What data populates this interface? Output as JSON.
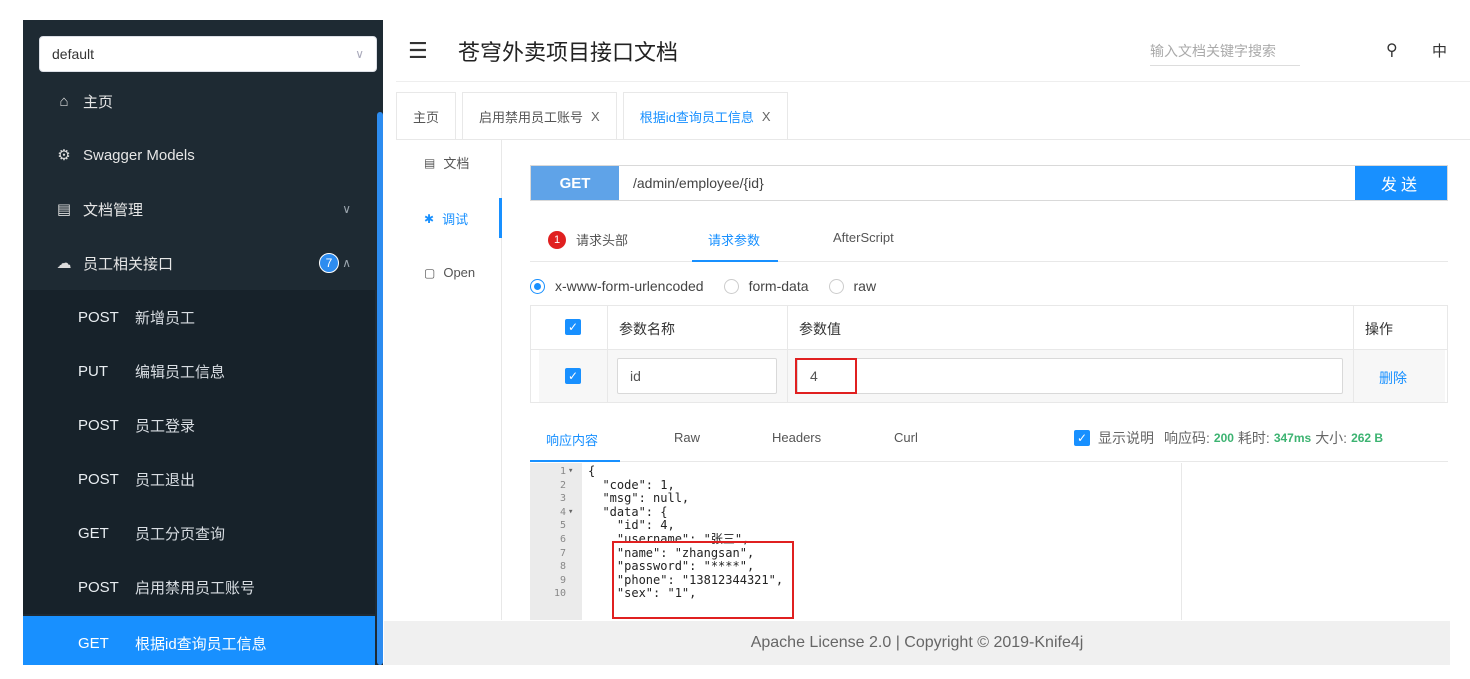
{
  "sidebar": {
    "group_select": "default",
    "home": "主页",
    "swagger_models": "Swagger Models",
    "doc_manage": "文档管理",
    "employee_group": "员工相关接口",
    "employee_count": "7",
    "endpoints": [
      {
        "method": "POST",
        "label": "新增员工"
      },
      {
        "method": "PUT",
        "label": "编辑员工信息"
      },
      {
        "method": "POST",
        "label": "员工登录"
      },
      {
        "method": "POST",
        "label": "员工退出"
      },
      {
        "method": "GET",
        "label": "员工分页查询"
      },
      {
        "method": "POST",
        "label": "启用禁用员工账号"
      },
      {
        "method": "GET",
        "label": "根据id查询员工信息"
      }
    ]
  },
  "header": {
    "title": "苍穹外卖项目接口文档",
    "search_placeholder": "输入文档关键字搜索",
    "lang": "中"
  },
  "tabs": [
    {
      "label": "主页"
    },
    {
      "label": "启用禁用员工账号",
      "close": "X"
    },
    {
      "label": "根据id查询员工信息",
      "close": "X"
    }
  ],
  "mini_nav": {
    "doc": "文档",
    "debug": "调试",
    "open": "Open"
  },
  "request": {
    "method": "GET",
    "url": "/admin/employee/{id}",
    "send": "发送"
  },
  "param_tabs": {
    "badge": "1",
    "headers": "请求头部",
    "params": "请求参数",
    "after": "AfterScript"
  },
  "content_types": [
    "x-www-form-urlencoded",
    "form-data",
    "raw"
  ],
  "param_table": {
    "col_name": "参数名称",
    "col_value": "参数值",
    "col_action": "操作",
    "row": {
      "name": "id",
      "value": "4",
      "action": "删除"
    }
  },
  "response": {
    "tabs": [
      "响应内容",
      "Raw",
      "Headers",
      "Curl"
    ],
    "show_desc": "显示说明",
    "code_label": "响应码:",
    "code": "200",
    "time_label": "耗时:",
    "time": "347ms",
    "size_label": "大小:",
    "size": "262 B",
    "lines": [
      {
        "n": "1",
        "fold": "▾",
        "text": "{"
      },
      {
        "n": "2",
        "fold": "",
        "text": "  \"code\": 1,"
      },
      {
        "n": "3",
        "fold": "",
        "text": "  \"msg\": null,"
      },
      {
        "n": "4",
        "fold": "▾",
        "text": "  \"data\": {"
      },
      {
        "n": "5",
        "fold": "",
        "text": "    \"id\": 4,"
      },
      {
        "n": "6",
        "fold": "",
        "text": "    \"username\": \"张三\","
      },
      {
        "n": "7",
        "fold": "",
        "text": "    \"name\": \"zhangsan\","
      },
      {
        "n": "8",
        "fold": "",
        "text": "    \"password\": \"****\","
      },
      {
        "n": "9",
        "fold": "",
        "text": "    \"phone\": \"13812344321\","
      },
      {
        "n": "10",
        "fold": "",
        "text": "    \"sex\": \"1\","
      }
    ]
  },
  "footer": "Apache License 2.0 | Copyright © 2019-Knife4j"
}
